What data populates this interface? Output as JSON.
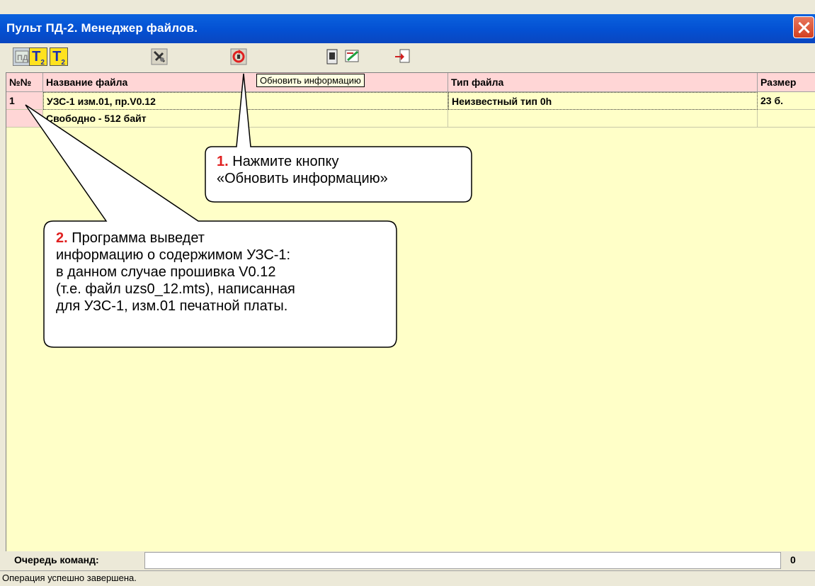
{
  "window": {
    "title": "Пульт ПД-2. Менеджер файлов."
  },
  "toolbar": {
    "btn_t2a": "T",
    "btn_t2a_sub": "2",
    "btn_t2b": "T",
    "btn_t2b_sub": "2"
  },
  "table": {
    "headers": {
      "num": "№№",
      "name": "Название файла",
      "type": "Тип файла",
      "size": "Размер"
    },
    "rows": [
      {
        "num": "1",
        "name": "УЗС-1 изм.01, пр.V0.12",
        "type": "Неизвестный тип 0h",
        "size": "23 б."
      },
      {
        "num": "",
        "name": "Свободно - 512 байт",
        "type": "",
        "size": ""
      }
    ]
  },
  "tooltip": "Обновить информацию",
  "callouts": {
    "c1_num": "1.",
    "c1_line1": " Нажмите кнопку",
    "c1_line2": "«Обновить информацию»",
    "c2_num": "2.",
    "c2_line1": " Программа выведет",
    "c2_line2": "информацию о содержимом УЗС-1:",
    "c2_line3": "в данном случае прошивка V0.12",
    "c2_line4": "(т.е. файл uzs0_12.mts), написанная",
    "c2_line5": "для УЗС-1, изм.01 печатной платы."
  },
  "queue": {
    "label": "Очередь команд:",
    "count": "0"
  },
  "status": "Операция успешно завершена.",
  "colors": {
    "title_bar": "#0450d2",
    "grid_bg": "#ffffc8",
    "header_bg": "#ffd6d6",
    "callout_number": "#e02020"
  }
}
